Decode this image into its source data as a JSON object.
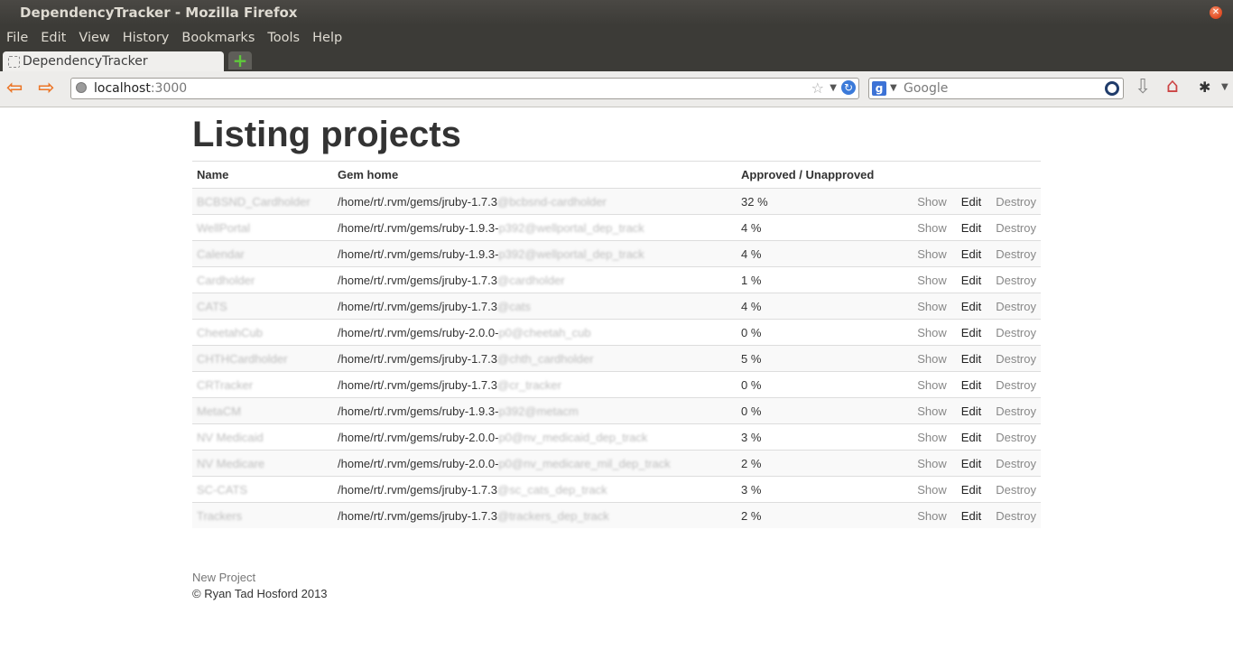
{
  "window": {
    "title": "DependencyTracker - Mozilla Firefox"
  },
  "menu": [
    "File",
    "Edit",
    "View",
    "History",
    "Bookmarks",
    "Tools",
    "Help"
  ],
  "tab": {
    "label": "DependencyTracker"
  },
  "url": {
    "host": "localhost",
    "port": ":3000"
  },
  "search": {
    "placeholder": "Google"
  },
  "page": {
    "title": "Listing projects",
    "headers": {
      "name": "Name",
      "gem_home": "Gem home",
      "approved": "Approved / Unapproved"
    },
    "actions": {
      "show": "Show",
      "edit": "Edit",
      "destroy": "Destroy"
    },
    "rows": [
      {
        "name": "BCBSND_Cardholder",
        "gem_prefix": "/home/rt/.rvm/gems/jruby-1.7.3",
        "gem_suffix": "@bcbsnd-cardholder",
        "pct": "32 %"
      },
      {
        "name": "WellPortal",
        "gem_prefix": "/home/rt/.rvm/gems/ruby-1.9.3-",
        "gem_suffix": "p392@wellportal_dep_track",
        "pct": "4 %"
      },
      {
        "name": "Calendar",
        "gem_prefix": "/home/rt/.rvm/gems/ruby-1.9.3-",
        "gem_suffix": "p392@wellportal_dep_track",
        "pct": "4 %"
      },
      {
        "name": "Cardholder",
        "gem_prefix": "/home/rt/.rvm/gems/jruby-1.7.3",
        "gem_suffix": "@cardholder",
        "pct": "1 %"
      },
      {
        "name": "CATS",
        "gem_prefix": "/home/rt/.rvm/gems/jruby-1.7.3",
        "gem_suffix": "@cats",
        "pct": "4 %"
      },
      {
        "name": "CheetahCub",
        "gem_prefix": "/home/rt/.rvm/gems/ruby-2.0.0-",
        "gem_suffix": "p0@cheetah_cub",
        "pct": "0 %"
      },
      {
        "name": "CHTHCardholder",
        "gem_prefix": "/home/rt/.rvm/gems/jruby-1.7.3",
        "gem_suffix": "@chth_cardholder",
        "pct": "5 %"
      },
      {
        "name": "CRTracker",
        "gem_prefix": "/home/rt/.rvm/gems/jruby-1.7.3",
        "gem_suffix": "@cr_tracker",
        "pct": "0 %"
      },
      {
        "name": "MetaCM",
        "gem_prefix": "/home/rt/.rvm/gems/ruby-1.9.3-",
        "gem_suffix": "p392@metacm",
        "pct": "0 %"
      },
      {
        "name": "NV Medicaid",
        "gem_prefix": "/home/rt/.rvm/gems/ruby-2.0.0-",
        "gem_suffix": "p0@nv_medicaid_dep_track",
        "pct": "3 %"
      },
      {
        "name": "NV Medicare",
        "gem_prefix": "/home/rt/.rvm/gems/ruby-2.0.0-",
        "gem_suffix": "p0@nv_medicare_mil_dep_track",
        "pct": "2 %"
      },
      {
        "name": "SC-CATS",
        "gem_prefix": "/home/rt/.rvm/gems/jruby-1.7.3",
        "gem_suffix": "@sc_cats_dep_track",
        "pct": "3 %"
      },
      {
        "name": "Trackers",
        "gem_prefix": "/home/rt/.rvm/gems/jruby-1.7.3",
        "gem_suffix": "@trackers_dep_track",
        "pct": "2 %"
      }
    ],
    "new_project": "New Project",
    "copyright": "© Ryan Tad Hosford 2013"
  },
  "colors": {
    "titlebar": "#3c3b37",
    "nav_arrow": "#ec7628",
    "link_muted": "#888888"
  }
}
